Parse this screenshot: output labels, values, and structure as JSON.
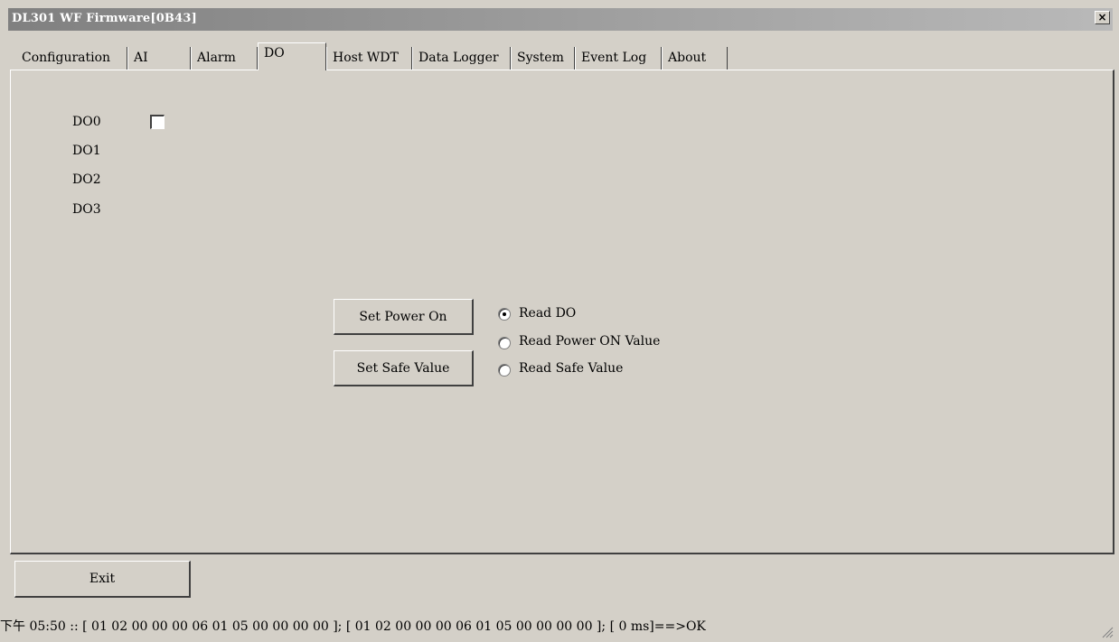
{
  "window": {
    "title": "DL301 WF Firmware[0B43]",
    "close_glyph": "×"
  },
  "tabs": [
    {
      "label": "Configuration"
    },
    {
      "label": "AI"
    },
    {
      "label": "Alarm"
    },
    {
      "label": "DO"
    },
    {
      "label": "Host WDT"
    },
    {
      "label": "Data Logger"
    },
    {
      "label": "System"
    },
    {
      "label": "Event Log"
    },
    {
      "label": "About"
    }
  ],
  "active_tab": "DO",
  "do_channels": [
    {
      "label": "DO0",
      "checked": false
    },
    {
      "label": "DO1"
    },
    {
      "label": "DO2"
    },
    {
      "label": "DO3"
    }
  ],
  "buttons": {
    "set_power_on": "Set Power On",
    "set_safe_value": "Set Safe Value",
    "exit": "Exit"
  },
  "read_mode": {
    "options": [
      "Read DO",
      "Read Power ON Value",
      "Read Safe Value"
    ],
    "selected": "Read DO"
  },
  "status": {
    "text": "下午 05:50 :: [ 01 02 00 00 00 06 01 05 00 00 00 00 ]; [ 01 02 00 00 00 06 01 05 00 00 00 00 ]; [ 0 ms]==>OK"
  }
}
